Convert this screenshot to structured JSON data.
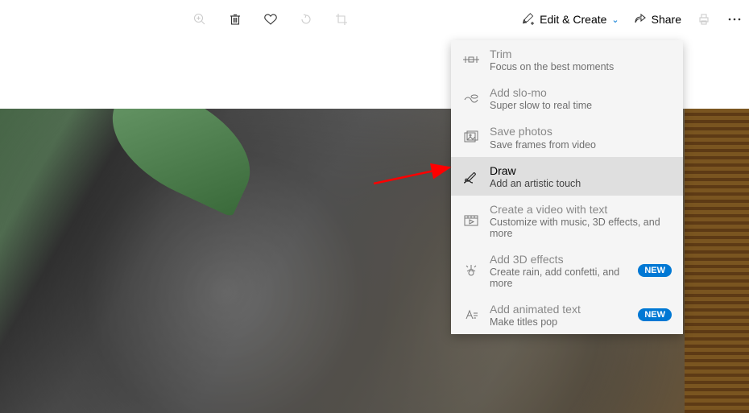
{
  "toolbar": {
    "edit_create_label": "Edit & Create",
    "share_label": "Share"
  },
  "menu": {
    "items": [
      {
        "title": "Trim",
        "sub": "Focus on the best moments",
        "icon": "trim-icon",
        "badge": null,
        "active": false
      },
      {
        "title": "Add slo-mo",
        "sub": "Super slow to real time",
        "icon": "slomo-icon",
        "badge": null,
        "active": false
      },
      {
        "title": "Save photos",
        "sub": "Save frames from video",
        "icon": "savephotos-icon",
        "badge": null,
        "active": false
      },
      {
        "title": "Draw",
        "sub": "Add an artistic touch",
        "icon": "draw-icon",
        "badge": null,
        "active": true
      },
      {
        "title": "Create a video with text",
        "sub": "Customize with music, 3D effects, and more",
        "icon": "createvideo-icon",
        "badge": null,
        "active": false
      },
      {
        "title": "Add 3D effects",
        "sub": "Create rain, add confetti, and more",
        "icon": "3deffects-icon",
        "badge": "NEW",
        "active": false
      },
      {
        "title": "Add animated text",
        "sub": "Make titles pop",
        "icon": "animatedtext-icon",
        "badge": "NEW",
        "active": false
      }
    ]
  }
}
